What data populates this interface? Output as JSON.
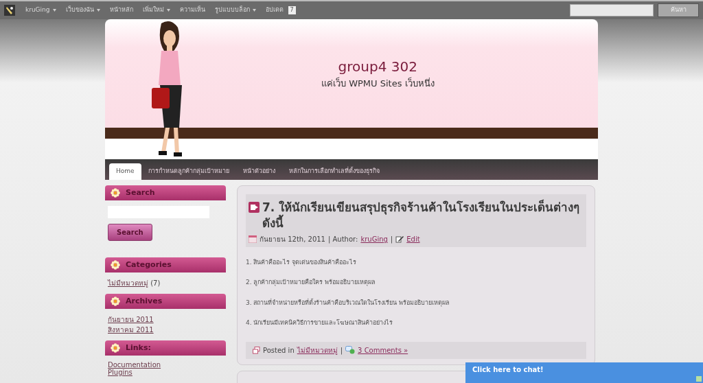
{
  "admin_bar": {
    "menu": [
      {
        "label": "kruGing",
        "dropdown": true
      },
      {
        "label": "เว็บของฉัน",
        "dropdown": true
      },
      {
        "label": "หน้าหลัก",
        "dropdown": false
      },
      {
        "label": "เพิ่มใหม่",
        "dropdown": true
      },
      {
        "label": "ความเห็น",
        "dropdown": false
      },
      {
        "label": "รูปแบบบล็อก",
        "dropdown": true
      },
      {
        "label": "อัปเดต",
        "dropdown": false,
        "badge": "7"
      }
    ],
    "search_button": "ค้นหา"
  },
  "header": {
    "title": "group4 302",
    "tagline": "แค่เว็บ WPMU Sites เว็บหนึ่ง"
  },
  "nav": [
    {
      "label": "Home",
      "selected": true
    },
    {
      "label": "การกำหนดลูกค้ากลุ่มเป้าหมาย",
      "selected": false
    },
    {
      "label": "หน้าตัวอย่าง",
      "selected": false
    },
    {
      "label": "หลักในการเลือกทำเลที่ตั้งของธุรกิจ",
      "selected": false
    }
  ],
  "sidebar": {
    "search": {
      "title": "Search",
      "button": "Search"
    },
    "categories": {
      "title": "Categories",
      "items": [
        {
          "link": "ไม่มีหมวดหมู่",
          "count": "(7)"
        }
      ]
    },
    "archives": {
      "title": "Archives",
      "items": [
        "กันยายน 2011",
        "สิงหาคม 2011"
      ]
    },
    "links": {
      "title": "Links:",
      "items": [
        "Documentation",
        "Plugins"
      ]
    }
  },
  "post": {
    "title": "7. ให้นักเรียนเขียนสรุปธุรกิจร้านค้าในโรงเรียนในประเด็นต่างๆ ดังนี้",
    "date": "กันยายน 12th, 2011",
    "author_label": "| Author:",
    "author": "kruGing",
    "edit_separator": "|",
    "edit": "Edit",
    "items": [
      "1. สินค้าคืออะไร จุดเด่นของสินค้าคืออะไร",
      "2. ลูกค้ากลุ่มเป้าหมายคือใคร พร้อมอธิบายเหตุผล",
      "3. สถานที่จำหน่ายหรือที่ตั้งร้านค้าคือบริเวณใดในโรงเรียน พร้อมอธิบายเหตุผล",
      "4. นักเรียนมีเทคนิควิธีการขายและโฆษณาสินค้าอย่างไร"
    ],
    "posted_in": "Posted in",
    "category": "ไม่มีหมวดหมู่",
    "category_separator": "|",
    "comments": "3 Comments »"
  },
  "chat": {
    "label": "Click here to chat!"
  }
}
